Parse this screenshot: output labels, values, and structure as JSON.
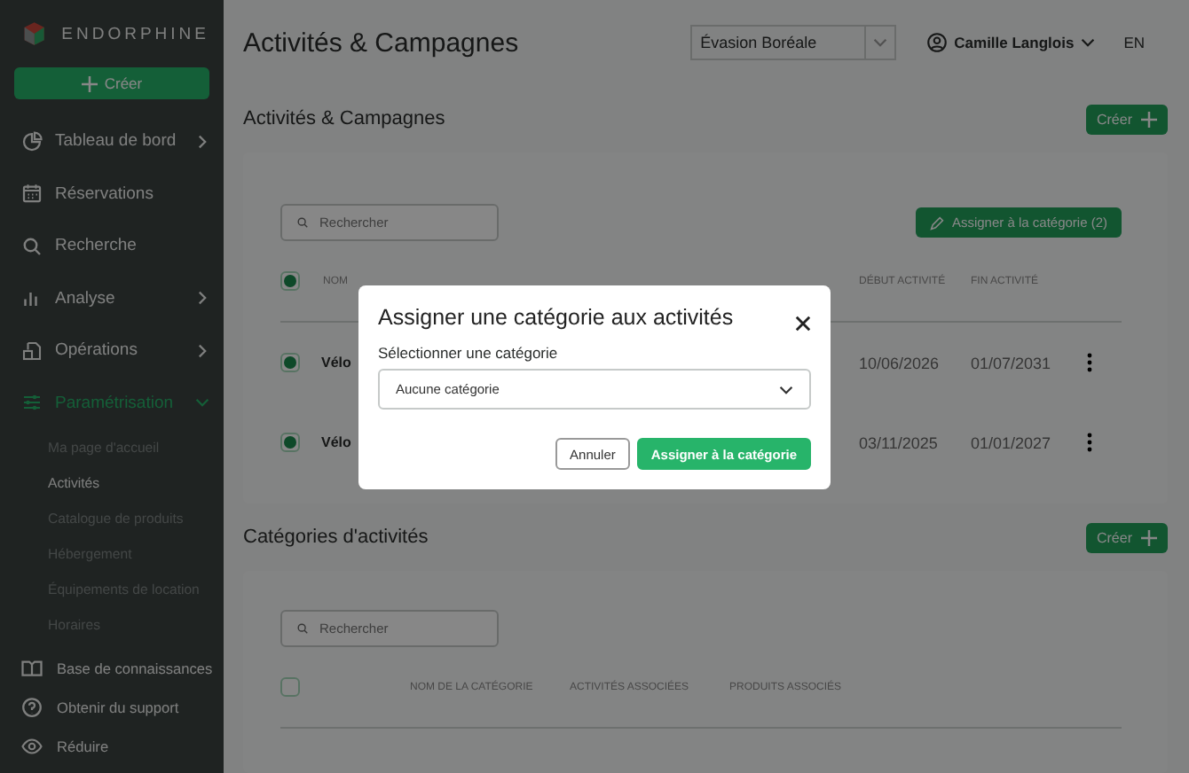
{
  "sidebar": {
    "brand": "ENDORPHINE",
    "create_button": "Créer",
    "items": [
      {
        "label": "Tableau de bord",
        "expanded": false,
        "selected": false
      },
      {
        "label": "Réservations",
        "selected": false
      },
      {
        "label": "Recherche",
        "selected": false
      },
      {
        "label": "Analyse",
        "expanded": false,
        "selected": false
      },
      {
        "label": "Opérations",
        "expanded": false,
        "selected": false
      },
      {
        "label": "Paramétrisation",
        "expanded": true,
        "selected": true,
        "children": [
          {
            "label": "Ma page d'accueil",
            "selected": false
          },
          {
            "label": "Activités",
            "selected": true
          },
          {
            "label": "Catalogue de produits",
            "selected": false
          },
          {
            "label": "Hébergement",
            "selected": false
          },
          {
            "label": "Équipements de location",
            "selected": false
          },
          {
            "label": "Horaires",
            "selected": false
          }
        ]
      }
    ],
    "footer": [
      "Base de connaissances",
      "Obtenir du support",
      "Réduire"
    ]
  },
  "header": {
    "title": "Activités & Campagnes",
    "organization": "Évasion Boréale",
    "user": "Camille Langlois",
    "language": "EN"
  },
  "sections": [
    {
      "title": "Activités & Campagnes",
      "create_button": "Créer",
      "search": {
        "placeholder": "Rechercher"
      },
      "action_button": "Assigner à la catégorie (2)",
      "table": {
        "all_checked": true,
        "columns": [
          "NOM",
          "DÉBUT ACTIVITÉ",
          "FIN ACTIVITÉ"
        ],
        "rows": [
          {
            "checked": true,
            "name": "Vélo",
            "start": "10/06/2026",
            "end": "01/07/2031"
          },
          {
            "checked": true,
            "name": "Vélo",
            "start": "03/11/2025",
            "end": "01/01/2027"
          }
        ]
      }
    },
    {
      "title": "Catégories d'activités",
      "create_button": "Créer",
      "search": {
        "placeholder": "Rechercher"
      },
      "table": {
        "all_checked": false,
        "columns": [
          "NOM DE LA CATÉGORIE",
          "ACTIVITÉS ASSOCIÉES",
          "PRODUITS ASSOCIÉS"
        ]
      }
    }
  ],
  "modal": {
    "title": "Assigner une catégorie aux activités",
    "field_label": "Sélectionner une catégorie",
    "select_value": "Aucune catégorie",
    "buttons": [
      {
        "label": "Annuler",
        "kind": "secondary"
      },
      {
        "label": "Assigner à la catégorie",
        "kind": "primary"
      }
    ]
  }
}
